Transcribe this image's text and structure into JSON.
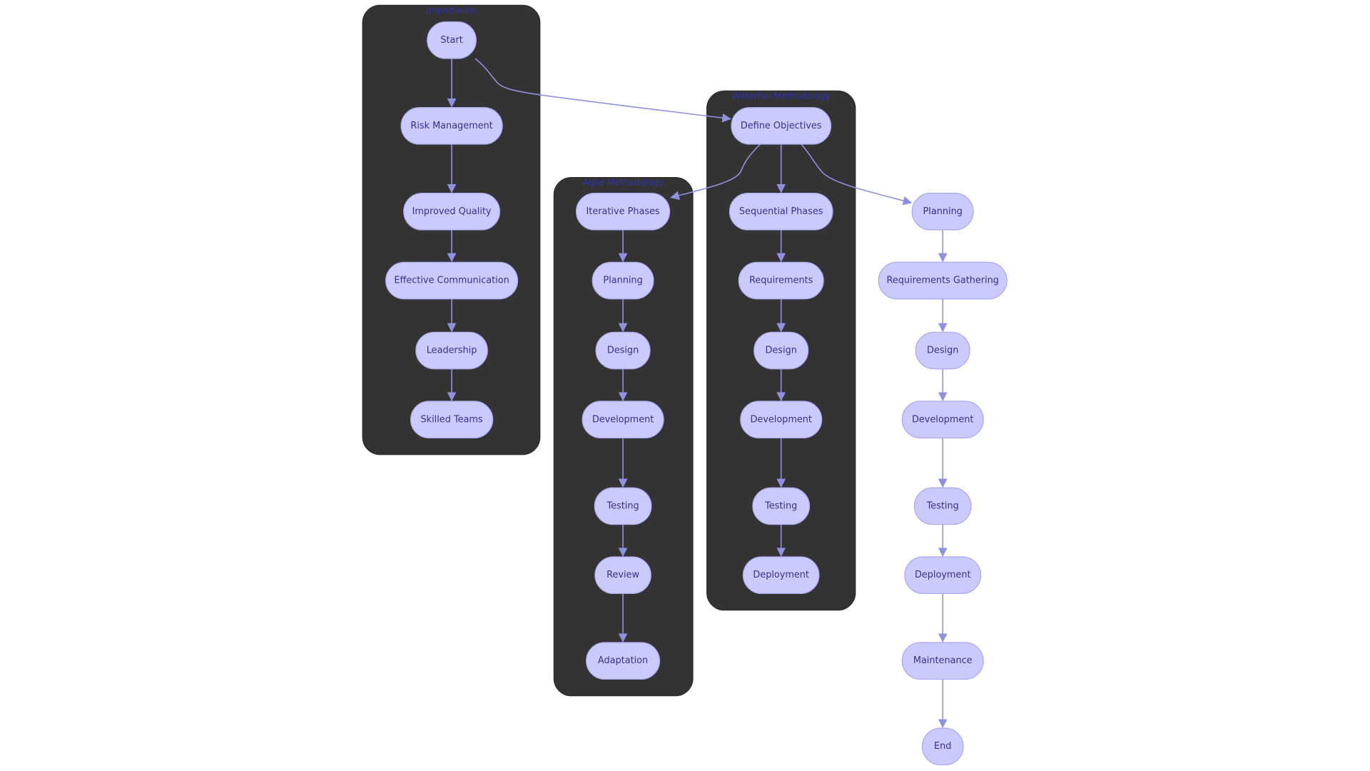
{
  "diagram": {
    "colors": {
      "cluster": "#333333",
      "node_fill": "#cacafc",
      "node_text": "#33338a",
      "edge": "#9090e0",
      "cluster_title": "#3333b3"
    },
    "clusters": [
      {
        "id": "importance",
        "title": "Importance",
        "nodes": [
          "Start",
          "Risk Management",
          "Improved Quality",
          "Effective Communication",
          "Leadership",
          "Skilled Teams"
        ]
      },
      {
        "id": "agile",
        "title": "Agile Methodology",
        "nodes": [
          "Iterative Phases",
          "Planning",
          "Design",
          "Development",
          "Testing",
          "Review",
          "Adaptation"
        ]
      },
      {
        "id": "waterfall",
        "title": "Waterfall Methodology",
        "nodes": [
          "Define Objectives",
          "Sequential Phases",
          "Requirements",
          "Design",
          "Development",
          "Testing",
          "Deployment"
        ]
      },
      {
        "id": "lifecycle",
        "title": "",
        "nodes": [
          "Planning",
          "Requirements Gathering",
          "Design",
          "Development",
          "Testing",
          "Deployment",
          "Maintenance",
          "End"
        ]
      }
    ],
    "cross_edges": [
      {
        "from": "Start",
        "to": "Define Objectives"
      },
      {
        "from": "Define Objectives",
        "to": "Iterative Phases"
      },
      {
        "from": "Define Objectives",
        "to": "Planning"
      }
    ]
  }
}
